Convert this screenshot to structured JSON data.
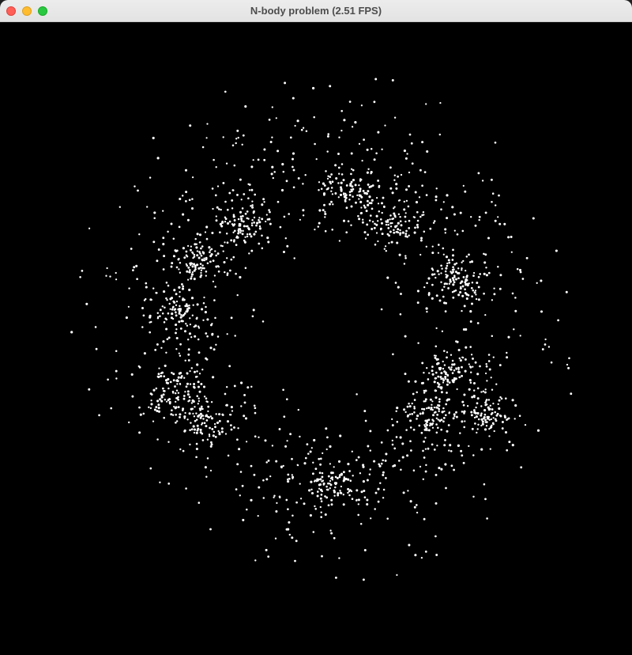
{
  "window": {
    "title": "N-body problem (2.51 FPS)",
    "controls": {
      "close": {
        "icon": "close-dot-icon",
        "color": "#ff5f57"
      },
      "minimize": {
        "icon": "minimize-dot-icon",
        "color": "#febc2e"
      },
      "zoom": {
        "icon": "zoom-dot-icon",
        "color": "#28c840"
      }
    }
  },
  "simulation": {
    "background_color": "#000000",
    "particle_color": "#ffffff"
  }
}
